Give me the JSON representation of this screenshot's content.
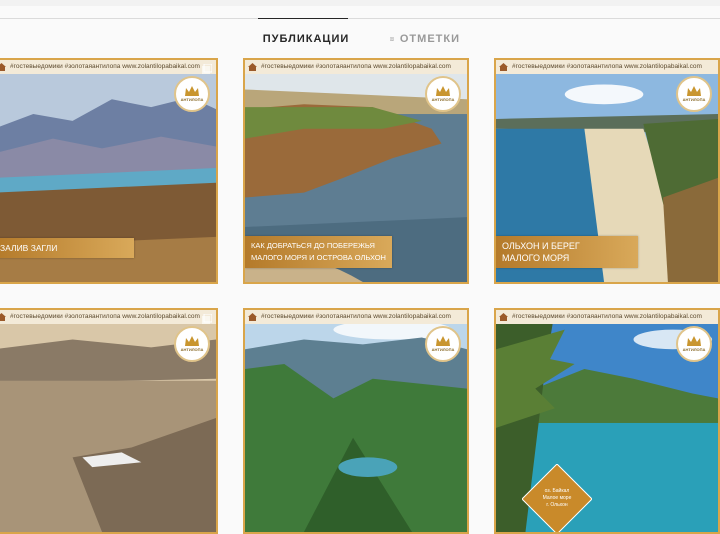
{
  "tabs": [
    {
      "label": "ПУБЛИКАЦИИ",
      "icon": "grid-icon",
      "active": true
    },
    {
      "label": "ОТМЕТКИ",
      "icon": "tag-icon",
      "active": false
    }
  ],
  "hashtags": "#гостевыедомики #золотаяантилопа www.zolantilopabaikal.com",
  "logo_text": "АНТИЛОПА",
  "posts": [
    {
      "caption": "ЗАЛИВ ЗАГЛИ"
    },
    {
      "caption": "КАК ДОБРАТЬСЯ ДО ПОБЕРЕЖЬЯ\nМАЛОГО МОРЯ И ОСТРОВА ОЛЬХОН"
    },
    {
      "caption": "ОЛЬХОН И БЕРЕГ\nМАЛОГО МОРЯ"
    },
    {
      "caption": ""
    },
    {
      "caption": ""
    },
    {
      "caption": "оз. Байкал\nМалое море\nг. Ольхон"
    }
  ],
  "colors": {
    "accent": "#d9a54a",
    "tab_active": "#262626",
    "tab_inactive": "#999999"
  }
}
